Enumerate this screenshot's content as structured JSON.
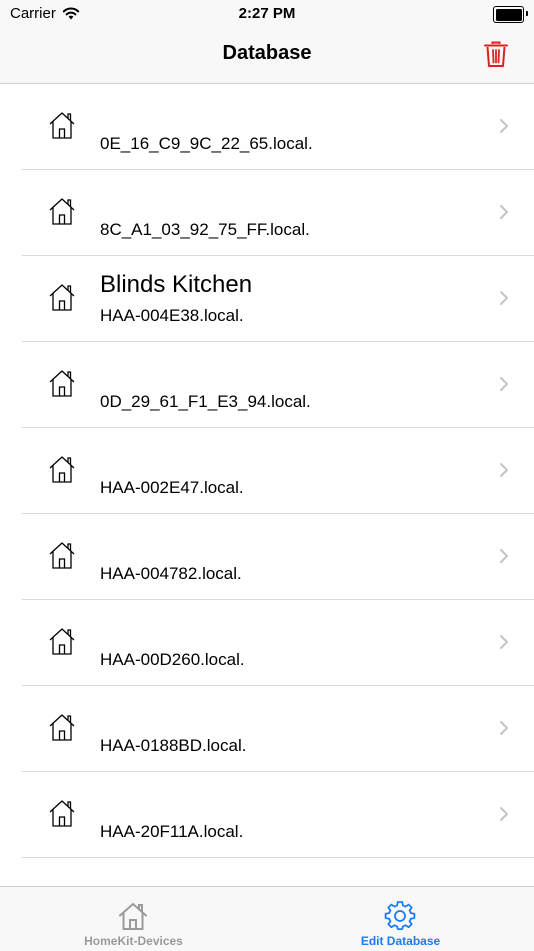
{
  "status_bar": {
    "carrier": "Carrier",
    "time": "2:27 PM"
  },
  "nav": {
    "title": "Database"
  },
  "rows": [
    {
      "name": "",
      "host": "0E_16_C9_9C_22_65.local."
    },
    {
      "name": "",
      "host": "8C_A1_03_92_75_FF.local."
    },
    {
      "name": "Blinds Kitchen",
      "host": "HAA-004E38.local."
    },
    {
      "name": "",
      "host": "0D_29_61_F1_E3_94.local."
    },
    {
      "name": "",
      "host": "HAA-002E47.local."
    },
    {
      "name": "",
      "host": "HAA-004782.local."
    },
    {
      "name": "",
      "host": "HAA-00D260.local."
    },
    {
      "name": "",
      "host": "HAA-0188BD.local."
    },
    {
      "name": "",
      "host": "HAA-20F11A.local."
    }
  ],
  "tabs": [
    {
      "label": "HomeKit-Devices",
      "icon": "house-icon"
    },
    {
      "label": "Edit Database",
      "icon": "gear-icon"
    }
  ],
  "colors": {
    "accent": "#1a7cf4",
    "destructive": "#e02020",
    "inactive": "#9a9a9a"
  }
}
